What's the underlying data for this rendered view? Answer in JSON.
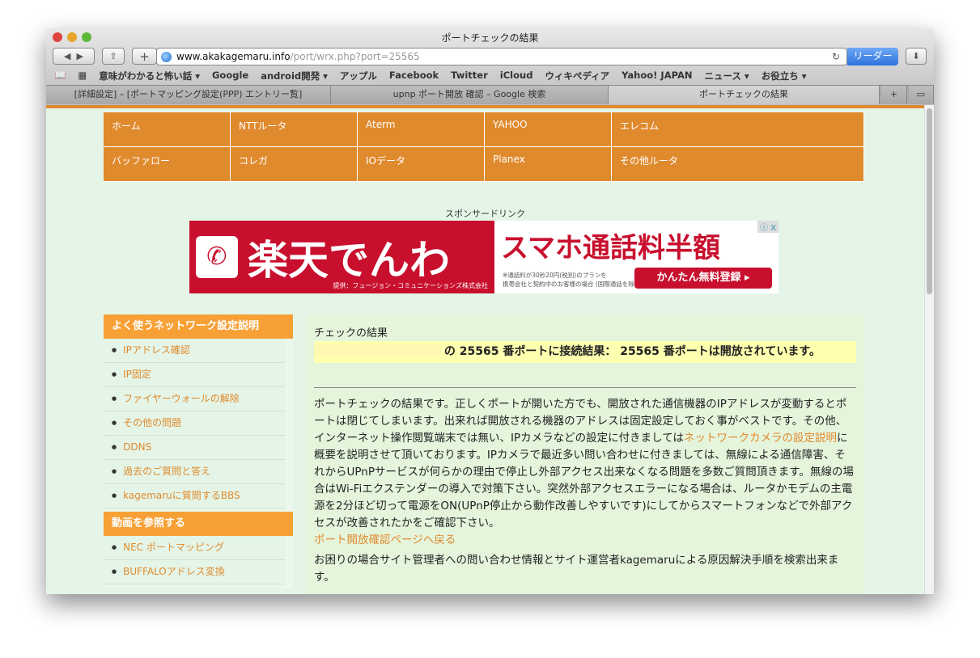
{
  "window": {
    "title": "ポートチェックの結果"
  },
  "toolbar": {
    "url_host": "www.akakagemaru.info",
    "url_path": "/port/wrx.php?port=25565",
    "reader": "リーダー",
    "add": "+"
  },
  "bookmarks": [
    "意味がわかると怖い話 ▾",
    "Google",
    "android開発 ▾",
    "アップル",
    "Facebook",
    "Twitter",
    "iCloud",
    "ウィキペディア",
    "Yahoo! JAPAN",
    "ニュース ▾",
    "お役立ち ▾"
  ],
  "tabs": [
    "[詳細設定] – [ポートマッピング設定(PPP) エントリー覧]",
    "upnp ポート開放 確認 – Google 検索",
    "ポートチェックの結果"
  ],
  "nav": [
    "ホーム",
    "NTTルータ",
    "Aterm",
    "YAHOO",
    "エレコム",
    "バッファロー",
    "コレガ",
    "IOデータ",
    "Planex",
    "その他ルータ"
  ],
  "sponsor": "スポンサードリンク",
  "ad": {
    "brand": "楽天でんわ",
    "provider": "提供：フュージョン・コミュニケーションズ株式会社",
    "headline": "スマホ通話料半額",
    "note1": "※通話料が30秒20円(税別)のプランを",
    "note2": "携帯会社と契約中のお客様の場合 (国際通話を除く)",
    "cta": "かんたん無料登録 ▸",
    "close": "ⓘ X"
  },
  "sidebar": {
    "section1": "よく使うネットワーク設定説明",
    "items1": [
      "IPアドレス確認",
      "IP固定",
      "ファイヤーウォールの解除",
      "その他の問題",
      "DDNS",
      "過去のご質問と答え",
      "kagemaruに質問するBBS"
    ],
    "section2": "動画を参照する",
    "items2": [
      "NEC ポートマッピング",
      "BUFFALOアドレス変換"
    ]
  },
  "main": {
    "heading": "チェックの結果",
    "result": "の 25565 番ポートに接続結果： 25565 番ポートは開放されています。",
    "p1a": "ポートチェックの結果です。正しくポートが開いた方でも、開放された通信機器のIPアドレスが変動するとポートは閉じてしまいます。出来れば開放される機器のアドレスは固定設定しておく事がベストです。その他、インターネット操作閲覧端末では無い、IPカメラなどの設定に付きましては",
    "p1link": "ネットワークカメラの設定説明",
    "p1b": "に概要を説明させて頂いております。IPカメラで最近多い問い合わせに付きましては、無線による通信障害、それからUPnPサービスが何らかの理由で停止し外部アクセス出来なくなる問題を多数ご質問頂きます。無線の場合はWi-Fiエクステンダーの導入で対策下さい。突然外部アクセスエラーになる場合は、ルータかモデムの主電源を2分ほど切って電源をON(UPnP停止から動作改善しやすいです)にしてからスマートフォンなどで外部アクセスが改善されたかをご確認下さい。",
    "back": "ポート開放確認ページへ戻る",
    "p2": "お困りの場合サイト管理者への問い合わせ情報とサイト運営者kagemaruによる原因解決手順を検索出来ます。"
  }
}
